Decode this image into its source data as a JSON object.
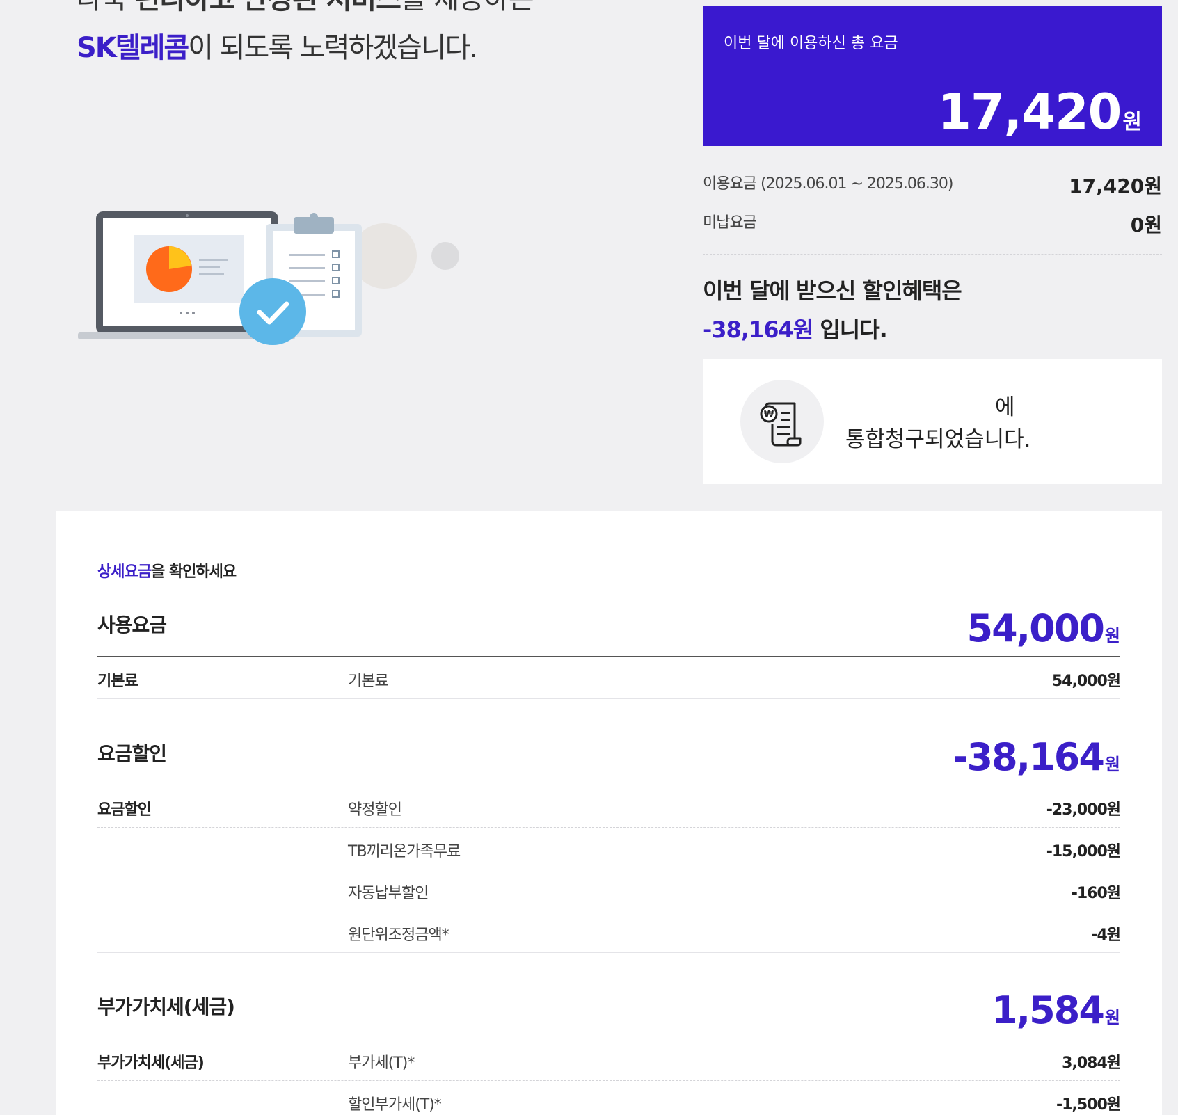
{
  "hero": {
    "clipped_line_part1": "다국 ",
    "clipped_line_bold1": "편리하고",
    "clipped_line_part2": " ",
    "clipped_line_bold2": "안정된 서비스",
    "clipped_line_part3": "를 제공하는",
    "brand": "SK텔레콤",
    "line_rest": "이 되도록 노력하겠습니다."
  },
  "total": {
    "label": "이번 달에 이용하신 총 요금",
    "amount": "17,420",
    "unit": "원"
  },
  "fees": [
    {
      "label": "이용요금 (2025.06.01 ~ 2025.06.30)",
      "value": "17,420원"
    },
    {
      "label": "미납요금",
      "value": "0원"
    }
  ],
  "benefit": {
    "line1": "이번 달에 받으신 할인혜택은",
    "amount": "-38,164원",
    "suffix": " 입니다."
  },
  "notice": {
    "line1": "에",
    "line2": "통합청구되었습니다.",
    "icon": "won-receipt-icon"
  },
  "detail": {
    "title_accent": "상세요금",
    "title_rest": "을 확인하세요",
    "sections": [
      {
        "name": "사용요금",
        "amount": "54,000",
        "unit": "원",
        "rows": [
          {
            "group": "기본료",
            "item": "기본료",
            "value": "54,000원"
          }
        ]
      },
      {
        "name": "요금할인",
        "amount": "-38,164",
        "unit": "원",
        "rows": [
          {
            "group": "요금할인",
            "item": "약정할인",
            "value": "-23,000원"
          },
          {
            "group": "",
            "item": "TB끼리온가족무료",
            "value": "-15,000원"
          },
          {
            "group": "",
            "item": "자동납부할인",
            "value": "-160원"
          },
          {
            "group": "",
            "item": "원단위조정금액*",
            "value": "-4원"
          }
        ]
      },
      {
        "name": "부가가치세(세금)",
        "amount": "1,584",
        "unit": "원",
        "rows": [
          {
            "group": "부가가치세(세금)",
            "item": "부가세(T)*",
            "value": "3,084원"
          },
          {
            "group": "",
            "item": "할인부가세(T)*",
            "value": "-1,500원"
          }
        ]
      }
    ]
  },
  "colors": {
    "accent": "#3a19cf",
    "background": "#f0f0f2"
  }
}
